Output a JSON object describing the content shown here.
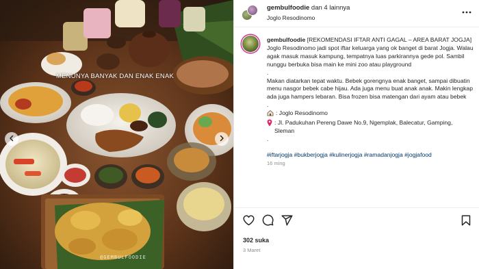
{
  "photo": {
    "caption_overlay": "MENUNYA BANYAK DAN ENAK ENAK",
    "watermark": "@GEMBULFOODIE"
  },
  "header": {
    "username": "gembulfoodie",
    "collab_text": "dan 4 lainnya",
    "location": "Joglo Resodinomo"
  },
  "caption": {
    "username": "gembulfoodie",
    "title": "[REKOMENDASI IFTAR ANTI GAGAL – AREA BARAT JOGJA]",
    "paragraph1": "Joglo Resodinomo jadi spot iftar keluarga yang ok banget di barat Jogja. Walau agak masuk masuk kampung, tempatnya luas parkirannya gede pol. Sambil nunggu berbuka bisa main ke mini zoo atau playground",
    "dot1": ".",
    "paragraph2": "Makan diatarkan tepat waktu. Bebek gorengnya enak banget, sampai dibuatin menu nasgor bebek cabe hijau. Ada juga menu buat anak anak. Makin lengkap ada juga hampers lebaran. Bisa frozen bisa matengan dari ayam atau bebek",
    "dot2": ".",
    "place_name": ": Joglo Resodinomo",
    "address": ": Jl. Padukuhan Pereng Dawe No.9, Ngemplak, Balecatur, Gamping, Sleman",
    "dot3": ".",
    "hashtags": "#iftarjogja #bukberjogja #kulinerjogja #ramadanjogja #jogjafood",
    "time_ago": "16 ming"
  },
  "footer": {
    "likes": "302 suka",
    "date": "3 Maret"
  }
}
